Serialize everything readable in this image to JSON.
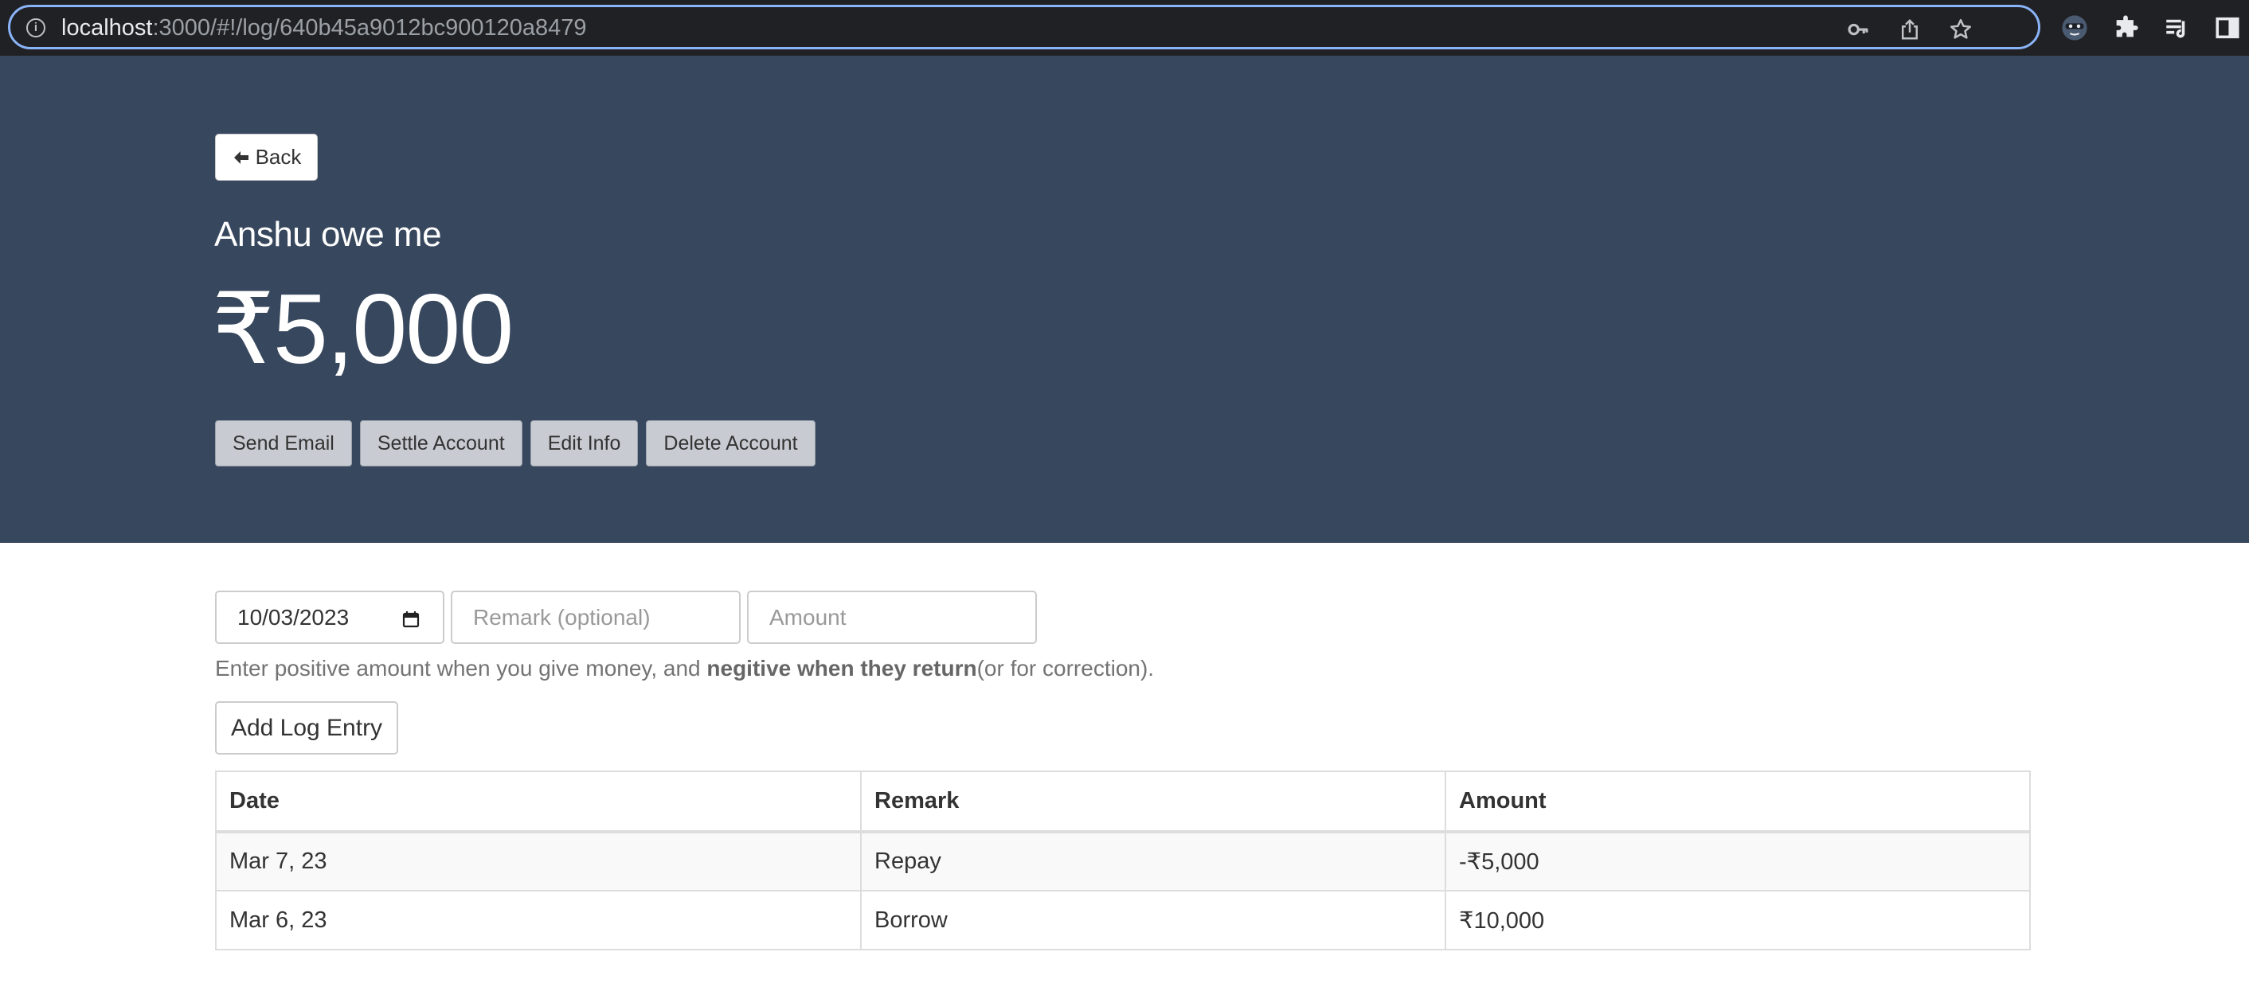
{
  "browser": {
    "url_host": "localhost",
    "url_path": ":3000/#!/log/640b45a9012bc900120a8479",
    "icons": [
      "info-icon",
      "key-icon",
      "share-icon",
      "star-icon",
      "profile-avatar-icon",
      "extensions-icon",
      "reading-list-icon",
      "side-panel-icon"
    ]
  },
  "hero": {
    "back_label": "Back",
    "title": "Anshu owe me",
    "balance": "₹5,000",
    "actions": {
      "send_email": "Send Email",
      "settle_account": "Settle Account",
      "edit_info": "Edit Info",
      "delete_account": "Delete Account"
    }
  },
  "form": {
    "date_value": "10/03/2023",
    "remark_placeholder": "Remark (optional)",
    "amount_placeholder": "Amount",
    "hint_prefix": "Enter positive amount when you give money, and ",
    "hint_bold": "negitive when they return",
    "hint_suffix": "(or for correction).",
    "add_label": "Add Log Entry"
  },
  "table": {
    "headers": {
      "date": "Date",
      "remark": "Remark",
      "amount": "Amount"
    },
    "rows": [
      {
        "date": "Mar 7, 23",
        "remark": "Repay",
        "amount": "-₹5,000"
      },
      {
        "date": "Mar 6, 23",
        "remark": "Borrow",
        "amount": "₹10,000"
      }
    ]
  },
  "colors": {
    "hero_bg": "#37475d",
    "chrome_bg": "#202124",
    "omnibox_focus": "#8ab4f8"
  }
}
